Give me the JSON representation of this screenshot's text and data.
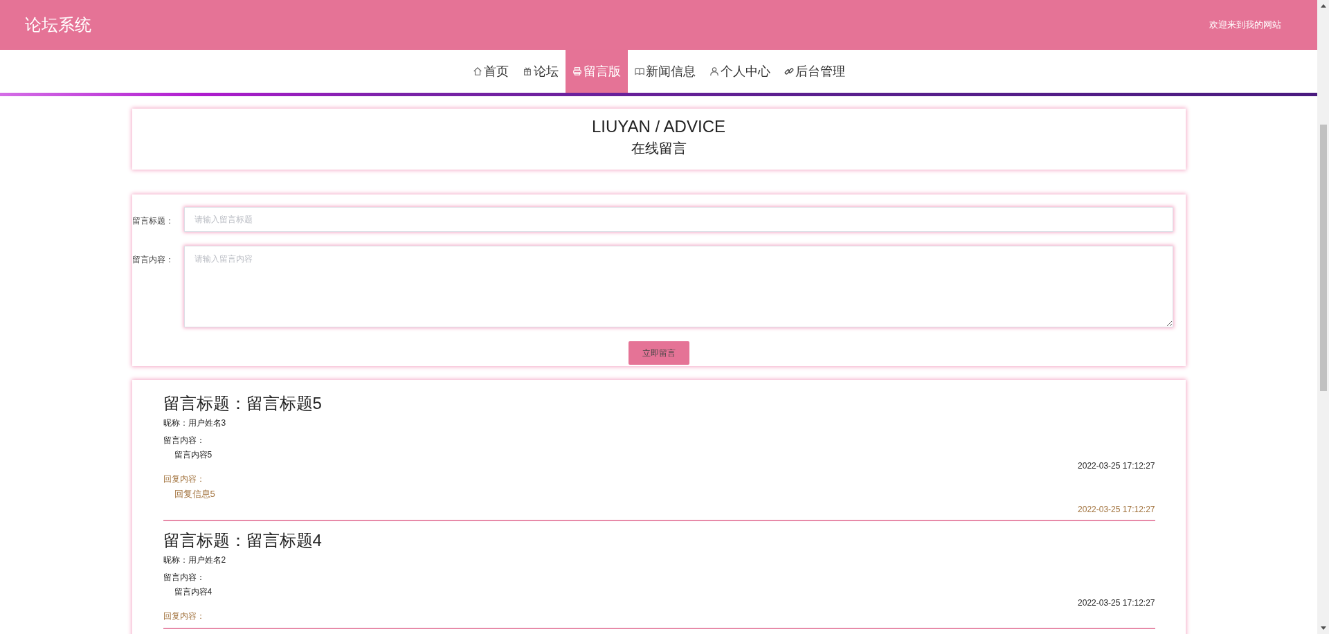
{
  "header": {
    "site_title": "论坛系统",
    "welcome": "欢迎来到我的网站"
  },
  "nav": [
    {
      "label": "首页",
      "selected": false
    },
    {
      "label": "论坛",
      "selected": false
    },
    {
      "label": "留言版",
      "selected": true
    },
    {
      "label": "新闻信息",
      "selected": false
    },
    {
      "label": "个人中心",
      "selected": false
    },
    {
      "label": "后台管理",
      "selected": false
    }
  ],
  "banner": {
    "title": "LIUYAN / ADVICE",
    "subtitle": "在线留言"
  },
  "form": {
    "title_label": "留言标题：",
    "title_placeholder": "请输入留言标题",
    "content_label": "留言内容：",
    "content_placeholder": "请输入留言内容",
    "submit": "立即留言"
  },
  "messages": [
    {
      "title": "留言标题：留言标题5",
      "nickname": "昵称：用户姓名3",
      "content_label": "留言内容：",
      "content": "留言内容5",
      "time": "2022-03-25 17:12:27",
      "reply_label": "回复内容：",
      "reply": "回复信息5",
      "reply_time": "2022-03-25 17:12:27"
    },
    {
      "title": "留言标题：留言标题4",
      "nickname": "昵称：用户姓名2",
      "content_label": "留言内容：",
      "content": "留言内容4",
      "time": "2022-03-25 17:12:27",
      "reply_label": "回复内容："
    }
  ]
}
